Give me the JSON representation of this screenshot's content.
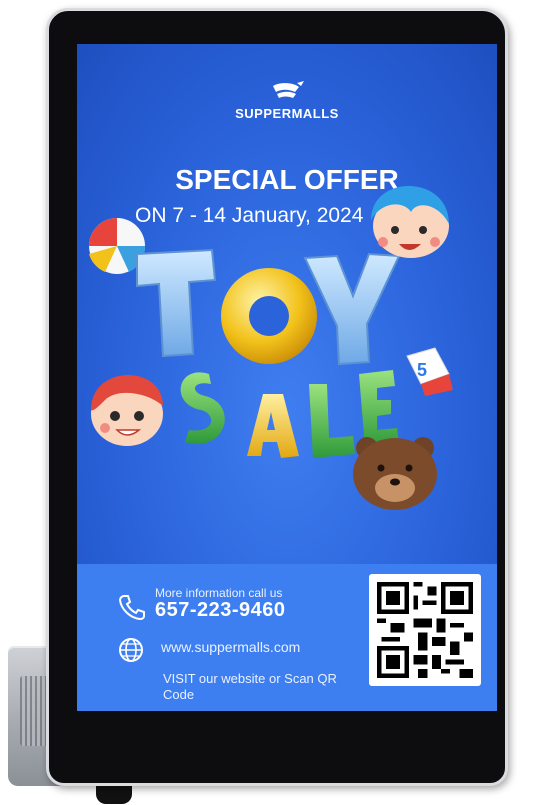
{
  "brand": {
    "name": "SUPPERMALLS",
    "logo_icon": "shopping-cart-icon"
  },
  "offer": {
    "headline": "SPECIAL OFFER",
    "dates": "ON 7 - 14 January, 2024"
  },
  "artwork": {
    "title_line1": "TOY",
    "title_line2": "SALE",
    "block_number": "5",
    "colors": {
      "screen": "#2b63db",
      "toy_blue": "#8fc6f4",
      "toy_yellow": "#f2c21a",
      "sale_green": "#3fb14a",
      "sale_yellow": "#f3c928"
    }
  },
  "contact": {
    "phone_label": "More information call us",
    "phone_number": "657-223-9460",
    "phone_icon": "phone-icon",
    "website": "www.suppermalls.com",
    "web_icon": "globe-icon",
    "visit_text": "VISIT our website or Scan QR Code",
    "qr_icon": "qr-code-icon",
    "panel_color": "#3d7ff0"
  }
}
